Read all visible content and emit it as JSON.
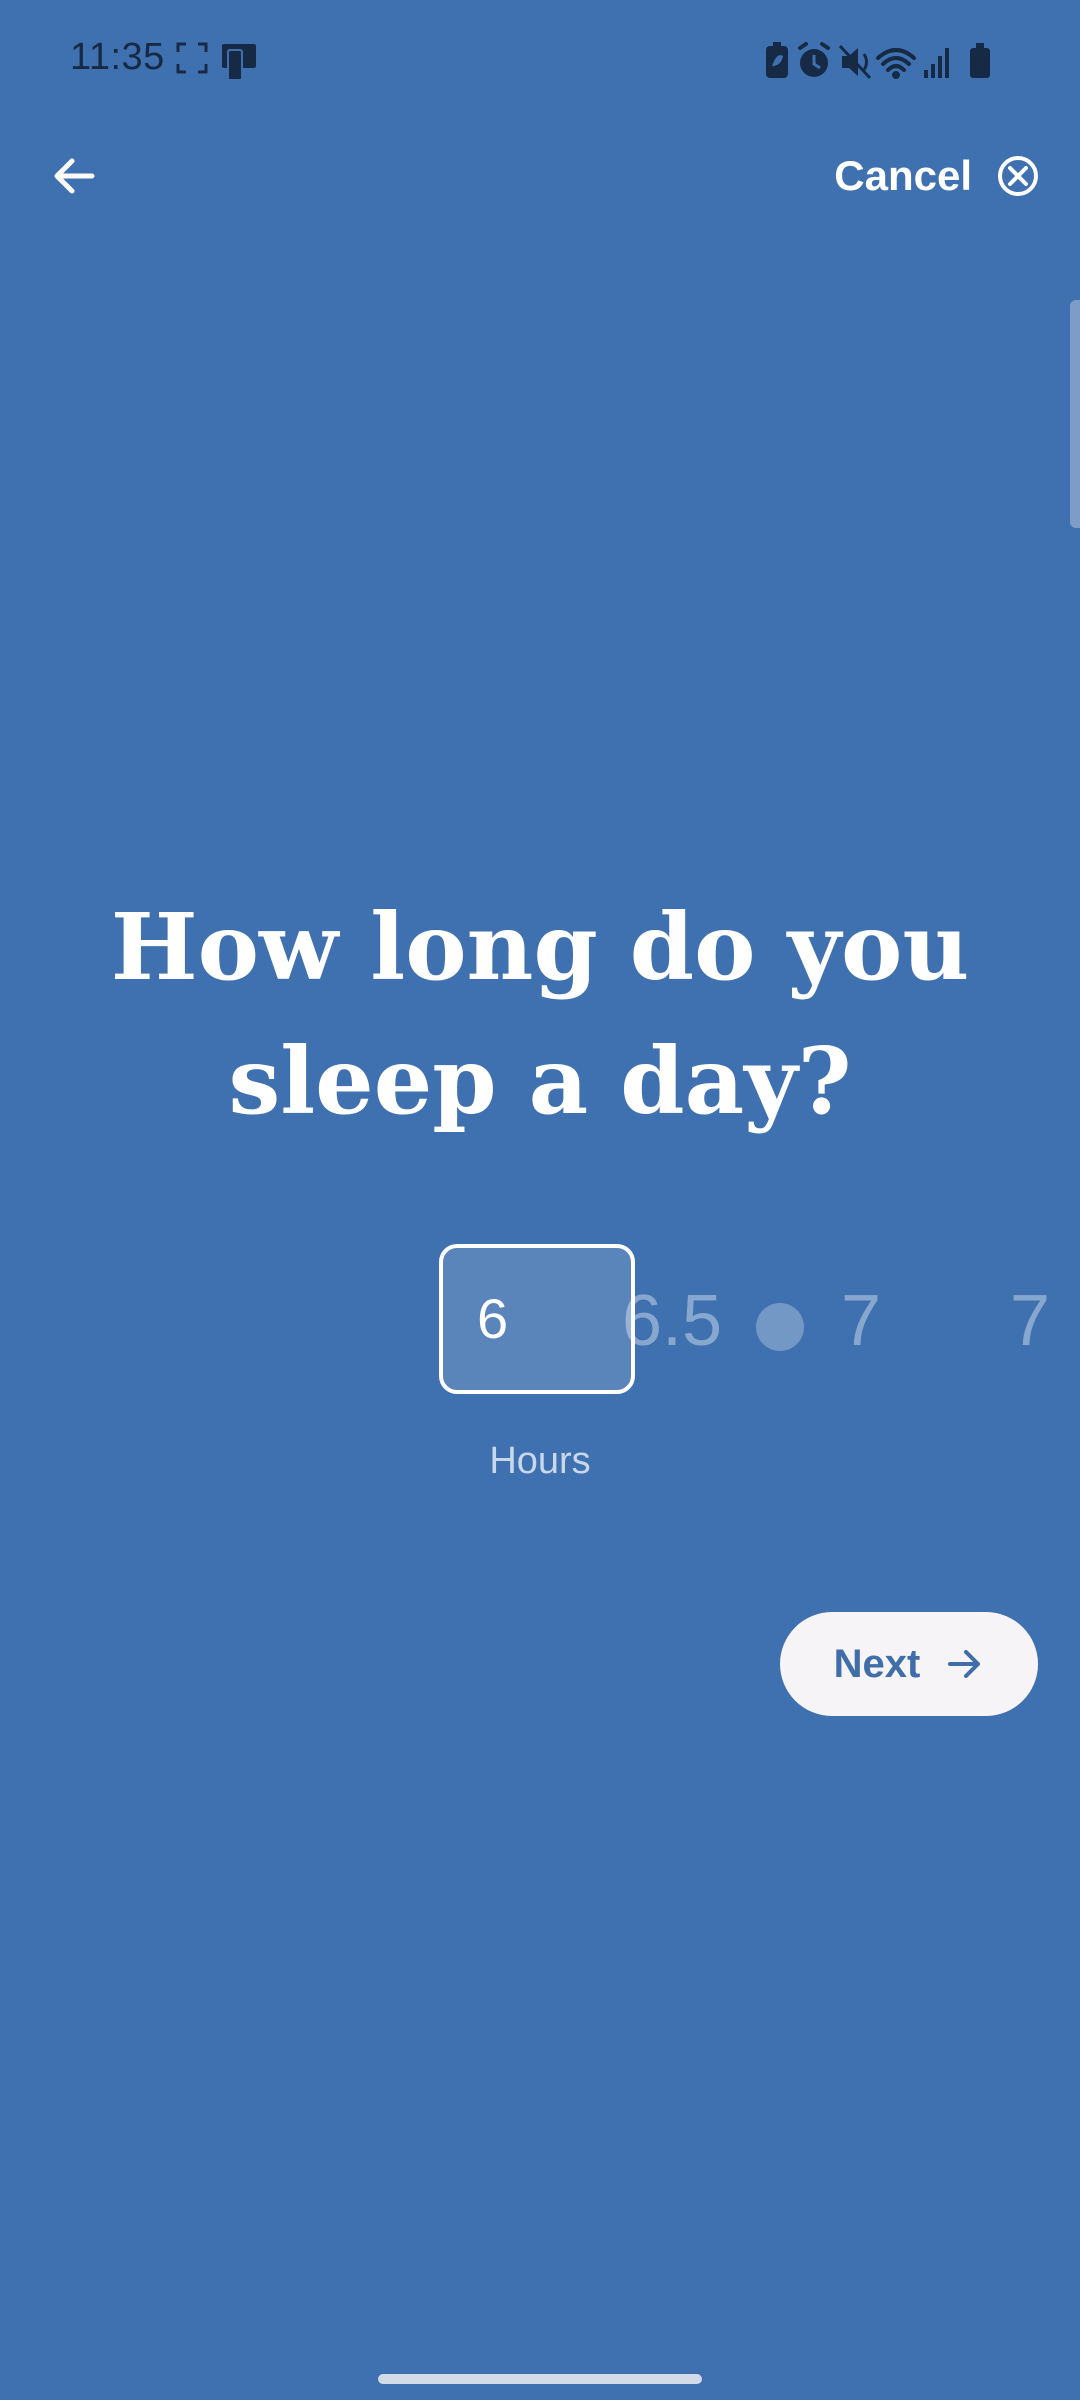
{
  "status_bar": {
    "time": "11:35",
    "left_icons": [
      "screenshot-frame-icon",
      "device-icon"
    ],
    "right_icons": [
      "battery-saver-icon",
      "alarm-icon",
      "mute-icon",
      "wifi-icon",
      "signal-icon",
      "battery-icon"
    ]
  },
  "header": {
    "back_icon": "arrow-left-icon",
    "cancel_label": "Cancel",
    "cancel_icon": "close-circle-icon"
  },
  "question": {
    "line1": "How long do you",
    "line2": "sleep a day?"
  },
  "picker": {
    "selected_value": "6",
    "options": [
      "6.5",
      "7",
      "7"
    ],
    "unit_label": "Hours"
  },
  "next_button": {
    "label": "Next",
    "icon": "arrow-right-icon"
  },
  "colors": {
    "background": "#3f71b0",
    "text": "#ffffff",
    "button_bg": "#f6f4f7",
    "button_text": "#3f6ea8"
  }
}
